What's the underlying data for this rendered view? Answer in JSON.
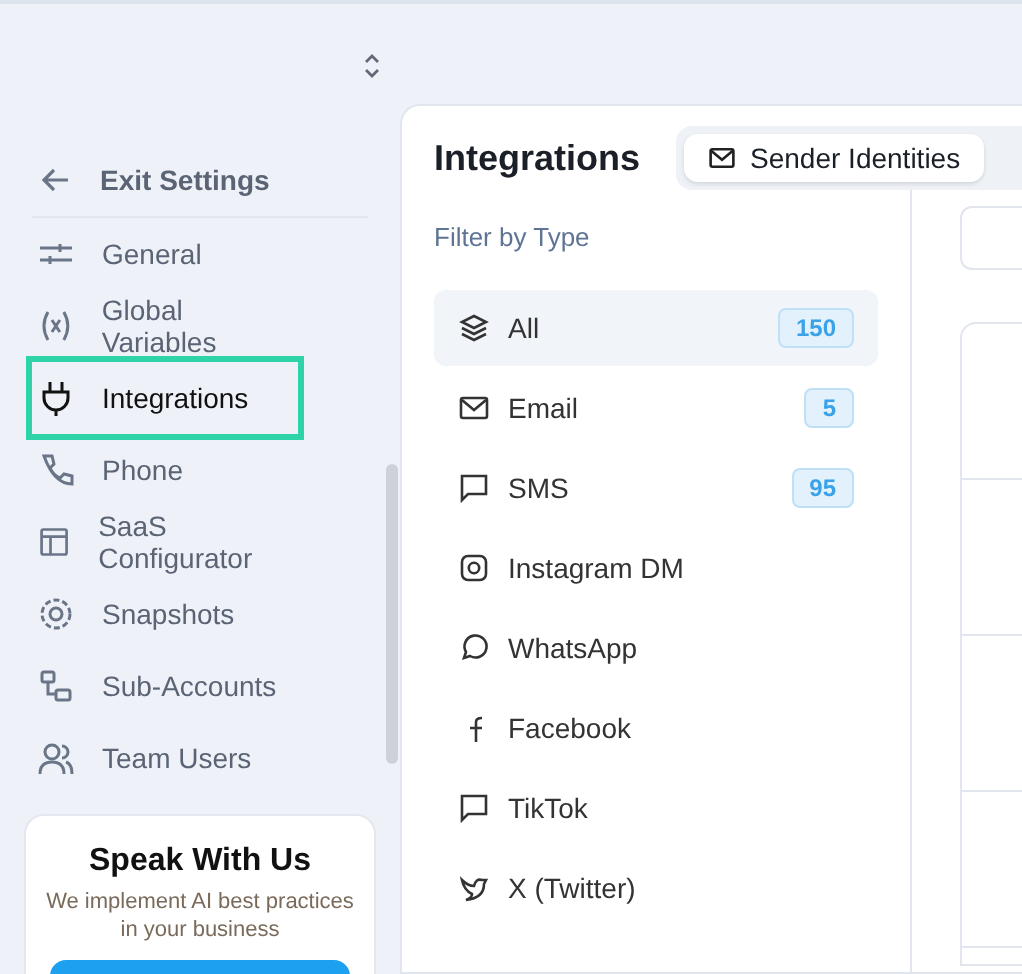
{
  "sidebar": {
    "back": "Exit Settings",
    "items": [
      {
        "label": "General",
        "selected": false
      },
      {
        "label": "Global Variables",
        "selected": false
      },
      {
        "label": "Integrations",
        "selected": true
      },
      {
        "label": "Phone",
        "selected": false
      },
      {
        "label": "SaaS Configurator",
        "selected": false
      },
      {
        "label": "Snapshots",
        "selected": false
      },
      {
        "label": "Sub-Accounts",
        "selected": false
      },
      {
        "label": "Team Users",
        "selected": false
      }
    ],
    "promo": {
      "title": "Speak With Us",
      "text": "We implement AI best practices in your business"
    }
  },
  "main": {
    "title": "Integrations",
    "tabs": [
      {
        "label": "Sender Identities",
        "selected": true
      }
    ],
    "filter_title": "Filter by Type",
    "filters": [
      {
        "label": "All",
        "count": "150",
        "selected": true
      },
      {
        "label": "Email",
        "count": "5",
        "selected": false
      },
      {
        "label": "SMS",
        "count": "95",
        "selected": false
      },
      {
        "label": "Instagram DM",
        "selected": false
      },
      {
        "label": "WhatsApp",
        "selected": false
      },
      {
        "label": "Facebook",
        "selected": false
      },
      {
        "label": "TikTok",
        "selected": false
      },
      {
        "label": "X (Twitter)",
        "selected": false
      }
    ]
  }
}
